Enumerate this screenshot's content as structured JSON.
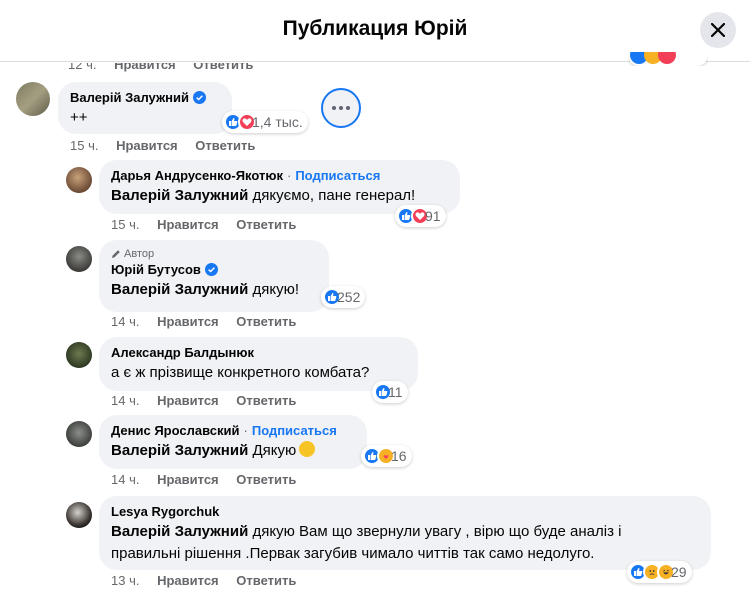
{
  "header": {
    "title": "Публикация Юрій"
  },
  "partial_prev": {
    "time": "12 ч.",
    "like": "Нравится",
    "reply": "Ответить"
  },
  "comments": [
    {
      "name": "Валерій Залужний",
      "text": "++",
      "reaction_count": "1,4 тыс.",
      "time": "15 ч.",
      "like": "Нравится",
      "reply": "Ответить"
    },
    {
      "name": "Дарья Андрусенко-Якотюк",
      "subscribe": "Подписаться",
      "mention": "Валерій Залужний",
      "text": " дякуємо, пане генерал!",
      "reaction_count": "91",
      "time": "15 ч.",
      "like": "Нравится",
      "reply": "Ответить"
    },
    {
      "author_tag": "Автор",
      "name": "Юрій Бутусов",
      "mention": "Валерій Залужний",
      "text": " дякую!",
      "reaction_count": "252",
      "time": "14 ч.",
      "like": "Нравится",
      "reply": "Ответить"
    },
    {
      "name": "Александр Балдынюк",
      "text": "а є ж прізвище конкретного комбата?",
      "reaction_count": "11",
      "time": "14 ч.",
      "like": "Нравится",
      "reply": "Ответить"
    },
    {
      "name": "Денис Ярославский",
      "subscribe": "Подписаться",
      "mention": "Валерій Залужний",
      "text": " Дякую",
      "reaction_count": "16",
      "time": "14 ч.",
      "like": "Нравится",
      "reply": "Ответить"
    },
    {
      "name": "Lesya Rygorchuk",
      "mention": "Валерій Залужний",
      "text_line1": " дякую Вам що звернули увагу , вірю що буде аналіз і",
      "text_line2": "правильні рішення .Первак загубив чимало читтів так само недолуго.",
      "reaction_count": "29",
      "time": "13 ч.",
      "like": "Нравится",
      "reply": "Ответить"
    }
  ],
  "icons": {
    "close": "close-icon",
    "verified": "verified-badge-icon",
    "more": "more-options-icon",
    "pencil": "pencil-icon",
    "like": "like-reaction-icon",
    "love": "love-reaction-icon",
    "haha": "haha-reaction-icon",
    "care": "care-reaction-icon",
    "sad": "sad-reaction-icon"
  },
  "colors": {
    "accent": "#1877f2",
    "bubble": "#f0f2f5",
    "muted": "#65676b"
  }
}
